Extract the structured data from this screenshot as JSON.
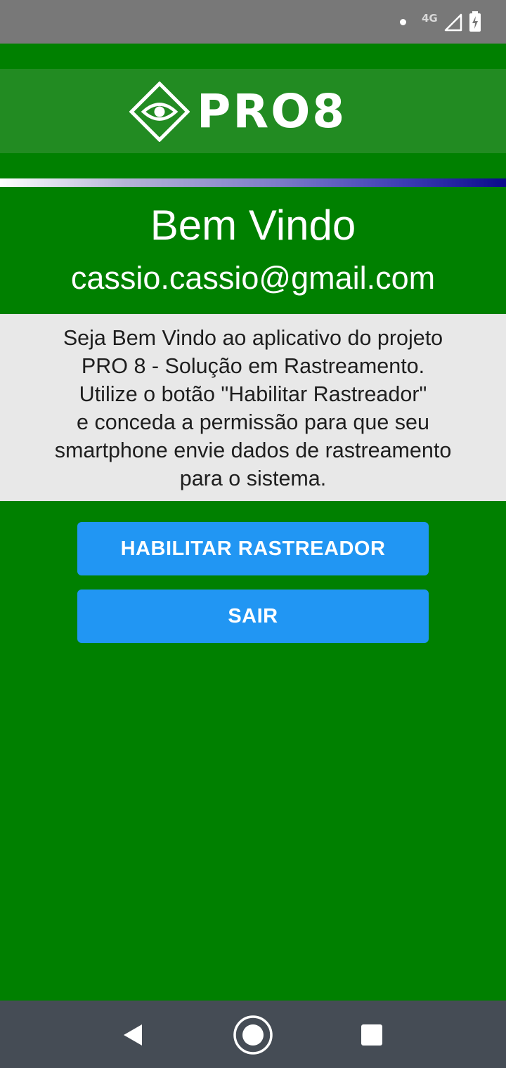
{
  "colors": {
    "status_bar": "#787878",
    "app_background": "#008000",
    "header_band": "#228b22",
    "info_panel": "#e8e8e8",
    "button": "#2196f3",
    "nav_bar": "#454c55"
  },
  "status_bar": {
    "network": "4G",
    "icons": [
      "notification-dot-icon",
      "signal-icon",
      "battery-charging-icon"
    ]
  },
  "header": {
    "logo_text": "PRO8",
    "logo_icon": "eye-diamond-icon"
  },
  "welcome": {
    "title": "Bem Vindo",
    "email": "cassio.cassio@gmail.com"
  },
  "info": {
    "text": "Seja Bem Vindo ao aplicativo do projeto\nPRO 8 - Solução em Rastreamento.\nUtilize o botão \"Habilitar Rastreador\"\ne conceda a permissão para que seu\nsmartphone envie dados de rastreamento\npara o sistema."
  },
  "actions": {
    "enable_tracker": "HABILITAR RASTREADOR",
    "exit": "SAIR"
  },
  "navigation": {
    "icons": [
      "back-icon",
      "home-icon",
      "recents-icon"
    ]
  }
}
